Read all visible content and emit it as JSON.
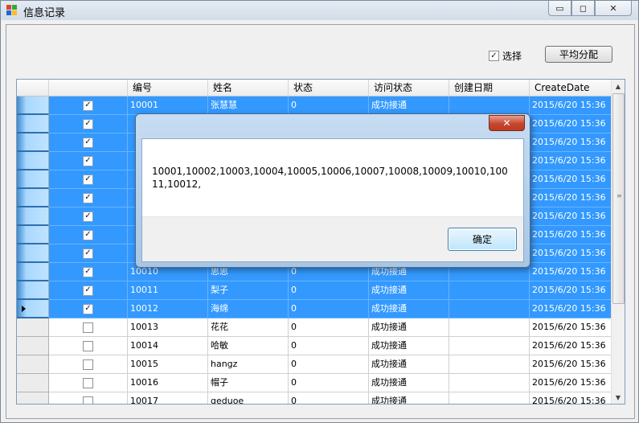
{
  "window": {
    "title": "信息记录"
  },
  "toolbar": {
    "select_label": "选择",
    "select_checked": true,
    "distribute_label": "平均分配"
  },
  "grid": {
    "columns": [
      "",
      "编号",
      "姓名",
      "状态",
      "访问状态",
      "创建日期",
      "CreateDate"
    ],
    "rows": [
      {
        "checked": true,
        "id": "10001",
        "name": "张慧慧",
        "status": "0",
        "visit": "成功接通",
        "created": "",
        "createdate": "2015/6/20 15:36",
        "selected": true
      },
      {
        "checked": true,
        "id": "",
        "name": "",
        "status": "",
        "visit": "",
        "created": "",
        "createdate": "2015/6/20 15:36",
        "selected": true
      },
      {
        "checked": true,
        "id": "",
        "name": "",
        "status": "",
        "visit": "",
        "created": "",
        "createdate": "2015/6/20 15:36",
        "selected": true
      },
      {
        "checked": true,
        "id": "",
        "name": "",
        "status": "",
        "visit": "",
        "created": "",
        "createdate": "2015/6/20 15:36",
        "selected": true
      },
      {
        "checked": true,
        "id": "",
        "name": "",
        "status": "",
        "visit": "",
        "created": "",
        "createdate": "2015/6/20 15:36",
        "selected": true
      },
      {
        "checked": true,
        "id": "",
        "name": "",
        "status": "",
        "visit": "",
        "created": "",
        "createdate": "2015/6/20 15:36",
        "selected": true
      },
      {
        "checked": true,
        "id": "",
        "name": "",
        "status": "",
        "visit": "",
        "created": "",
        "createdate": "2015/6/20 15:36",
        "selected": true
      },
      {
        "checked": true,
        "id": "",
        "name": "",
        "status": "",
        "visit": "",
        "created": "",
        "createdate": "2015/6/20 15:36",
        "selected": true
      },
      {
        "checked": true,
        "id": "",
        "name": "",
        "status": "",
        "visit": "",
        "created": "",
        "createdate": "2015/6/20 15:36",
        "selected": true
      },
      {
        "checked": true,
        "id": "10010",
        "name": "思思",
        "status": "0",
        "visit": "成功接通",
        "created": "",
        "createdate": "2015/6/20 15:36",
        "selected": true
      },
      {
        "checked": true,
        "id": "10011",
        "name": "梨子",
        "status": "0",
        "visit": "成功接通",
        "created": "",
        "createdate": "2015/6/20 15:36",
        "selected": true
      },
      {
        "checked": true,
        "id": "10012",
        "name": "海绵",
        "status": "0",
        "visit": "成功接通",
        "created": "",
        "createdate": "2015/6/20 15:36",
        "selected": true,
        "current": true
      },
      {
        "checked": false,
        "id": "10013",
        "name": "花花",
        "status": "0",
        "visit": "成功接通",
        "created": "",
        "createdate": "2015/6/20 15:36",
        "selected": false
      },
      {
        "checked": false,
        "id": "10014",
        "name": "哈敏",
        "status": "0",
        "visit": "成功接通",
        "created": "",
        "createdate": "2015/6/20 15:36",
        "selected": false
      },
      {
        "checked": false,
        "id": "10015",
        "name": "hangz",
        "status": "0",
        "visit": "成功接通",
        "created": "",
        "createdate": "2015/6/20 15:36",
        "selected": false
      },
      {
        "checked": false,
        "id": "10016",
        "name": "帽子",
        "status": "0",
        "visit": "成功接通",
        "created": "",
        "createdate": "2015/6/20 15:36",
        "selected": false
      },
      {
        "checked": false,
        "id": "10017",
        "name": "geduoe",
        "status": "0",
        "visit": "成功接通",
        "created": "",
        "createdate": "2015/6/20 15:36",
        "selected": false
      }
    ]
  },
  "dialog": {
    "message": "10001,10002,10003,10004,10005,10006,10007,10008,10009,10010,10011,10012,",
    "ok_label": "确定",
    "close_glyph": "✕"
  },
  "icons": {
    "minimize": "▭",
    "maximize": "◻",
    "close": "✕",
    "check": "✓",
    "scroll_up": "▲",
    "scroll_down": "▼"
  }
}
